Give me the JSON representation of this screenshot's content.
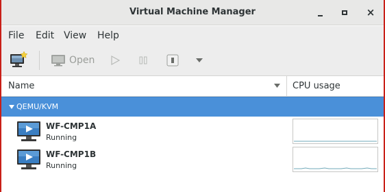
{
  "window": {
    "title": "Virtual Machine Manager",
    "controls": [
      "minimize",
      "maximize",
      "close"
    ],
    "close_label": "×"
  },
  "menu": {
    "file": "File",
    "edit": "Edit",
    "view": "View",
    "help": "Help"
  },
  "toolbar": {
    "new_vm_icon": "monitor-with-star-icon",
    "open_label": "Open",
    "run_icon": "play-icon",
    "pause_icon": "pause-icon",
    "shutdown_icon": "power-icon",
    "menu_icon": "dropdown-arrow-icon"
  },
  "columns": {
    "name": "Name",
    "cpu": "CPU usage"
  },
  "group": {
    "label": "QEMU/KVM",
    "expanded": true
  },
  "vms": [
    {
      "name": "WF-CMP1A",
      "status": "Running"
    },
    {
      "name": "WF-CMP1B",
      "status": "Running"
    }
  ],
  "colors": {
    "selection": "#4a90d9",
    "border_accent": "#c91f18",
    "sparkline": "#6fa8b8"
  }
}
